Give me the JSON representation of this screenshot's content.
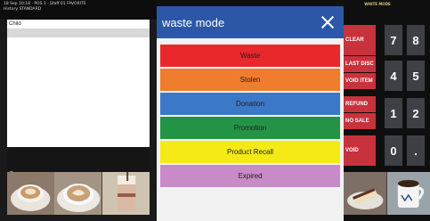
{
  "status": {
    "line1": "18 Sep 10:18 · POS 1 · Staff 01  FAVORITE",
    "line2": "History  STANDARD"
  },
  "order": {
    "rows": [
      "Child",
      ""
    ]
  },
  "total_label": "Tt",
  "modal": {
    "title": "waste mode",
    "options": [
      {
        "label": "Waste",
        "color": "#e8282b"
      },
      {
        "label": "Stolen",
        "color": "#f07d2d"
      },
      {
        "label": "Donation",
        "color": "#3b78c8"
      },
      {
        "label": "Promotion",
        "color": "#239446"
      },
      {
        "label": "Product Recall",
        "color": "#f5ea16"
      },
      {
        "label": "Expired",
        "color": "#c98ac8"
      }
    ]
  },
  "keypad": {
    "top_label": "WHITE MODE",
    "function_keys": [
      "CLEAR",
      "LAST DISC",
      "VOID ITEM",
      "REFUND",
      "NO SALE",
      "VOID"
    ],
    "numbers": [
      "7",
      "8",
      "4",
      "5",
      "1",
      "2",
      "0",
      "."
    ]
  },
  "tiles": {
    "left": [
      "coffee-cup-image",
      "cappuccino-image",
      "milkshake-image"
    ],
    "right": [
      "cake-slice-image",
      "tea-mug-image"
    ]
  }
}
